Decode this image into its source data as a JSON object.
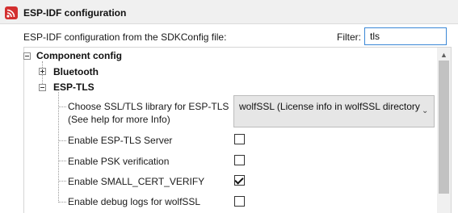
{
  "window": {
    "title": "ESP-IDF configuration"
  },
  "header": {
    "subtitle": "ESP-IDF configuration from the SDKConfig file:",
    "filter_label": "Filter:",
    "filter_value": "tls"
  },
  "tree": {
    "root": {
      "label": "Component config",
      "expanded": true
    },
    "bluetooth": {
      "label": "Bluetooth",
      "expanded": false
    },
    "esp_tls": {
      "label": "ESP-TLS",
      "expanded": true
    },
    "options": {
      "ssl_library": {
        "label_line1": "Choose SSL/TLS library for ESP-TLS",
        "label_line2": "(See help for more Info)",
        "selected": "wolfSSL (License info in wolfSSL directory"
      },
      "enable_server": {
        "label": "Enable ESP-TLS Server",
        "checked": false
      },
      "enable_psk": {
        "label": "Enable PSK verification",
        "checked": false
      },
      "small_cert_verify": {
        "label": "Enable SMALL_CERT_VERIFY",
        "checked": true
      },
      "debug_logs": {
        "label": "Enable debug logs for wolfSSL",
        "checked": false
      }
    }
  },
  "icons": {
    "app": "esp-idf-logo-icon",
    "collapse": "minus-box-icon",
    "expand": "plus-box-icon",
    "dropdown": "chevron-down-icon",
    "scroll_up": "triangle-up-icon",
    "check": "checkmark-icon"
  },
  "colors": {
    "title_bar_bg": "#f0f0f0",
    "app_icon": "#d32f2f",
    "filter_border": "#3a87d6",
    "dropdown_bg": "#e6e6e6",
    "scroll_thumb": "#c2c2c2"
  }
}
